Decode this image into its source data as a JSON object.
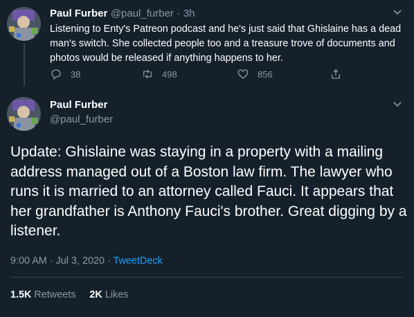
{
  "reply_tweet": {
    "author_name": "Paul Furber",
    "author_handle": "@paul_furber",
    "separator": "·",
    "time_ago": "3h",
    "text": "Listening to Enty's Patreon podcast and he's just said that Ghislaine has a dead man's switch. She collected people too and a treasure trove of documents and photos would be released if anything happens to her.",
    "replies": "38",
    "retweets": "498",
    "likes": "856"
  },
  "main_tweet": {
    "author_name": "Paul Furber",
    "author_handle": "@paul_furber",
    "text": "Update: Ghislaine was staying in a property with a mailing address managed out of a Boston law firm. The lawyer who runs it is married to an attorney called Fauci. It appears that her grandfather is Anthony Fauci's brother. Great digging by a listener.",
    "timestamp": "9:00 AM · Jul 3, 2020 · ",
    "source": "TweetDeck",
    "retweet_count": "1.5K",
    "retweet_label": "Retweets",
    "like_count": "2K",
    "like_label": "Likes"
  },
  "icons": [
    "avatar",
    "chevron-down-icon",
    "reply-icon",
    "retweet-icon",
    "like-icon",
    "share-icon"
  ],
  "colors": {
    "background": "#15202b",
    "muted": "#8899a6",
    "link": "#1da1f2",
    "divider": "#38444d"
  }
}
